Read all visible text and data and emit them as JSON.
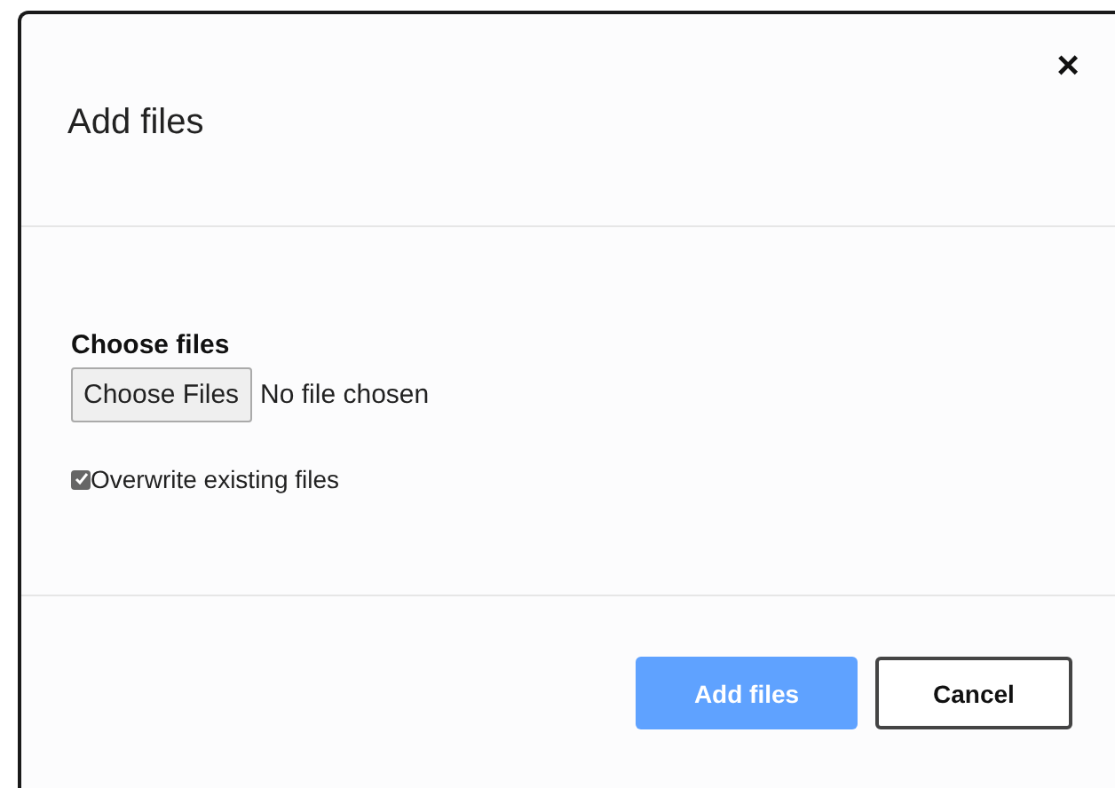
{
  "dialog": {
    "title": "Add files",
    "close": "×"
  },
  "field": {
    "label": "Choose files",
    "button": "Choose Files",
    "status": "No file chosen"
  },
  "option": {
    "label": "Overwrite existing files",
    "checked": true
  },
  "buttons": [
    {
      "label": "Add files",
      "kind": "primary",
      "disabled": true
    },
    {
      "label": "Cancel",
      "kind": "secondary",
      "disabled": false
    }
  ]
}
